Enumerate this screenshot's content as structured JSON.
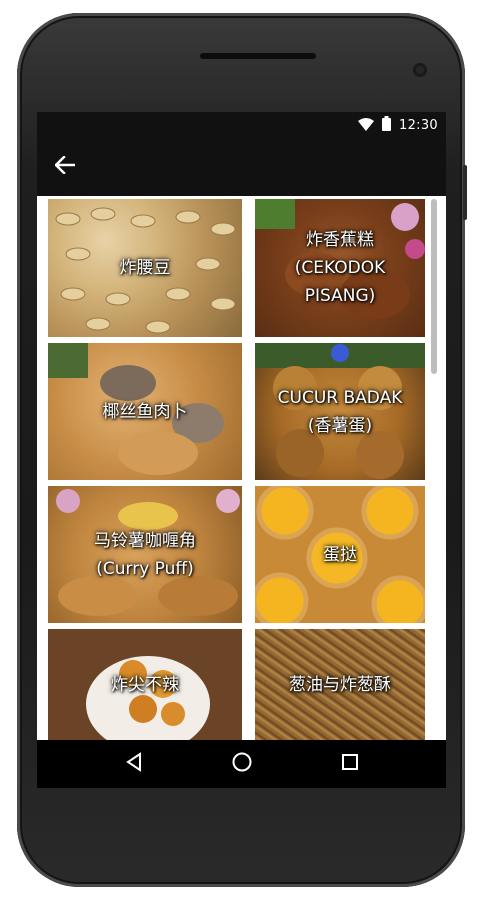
{
  "status_bar": {
    "time": "12:30",
    "icons": [
      "wifi-icon",
      "battery-icon"
    ]
  },
  "app_bar": {
    "back_icon": "arrow-back-icon"
  },
  "grid": {
    "items": [
      {
        "label": "炸腰豆"
      },
      {
        "label": "炸香蕉糕\n(CEKODOK\nPISANG)"
      },
      {
        "label": "椰丝鱼肉卜"
      },
      {
        "label": "CUCUR BADAK\n(香薯蛋)"
      },
      {
        "label": "马铃薯咖喱角\n(Curry Puff)"
      },
      {
        "label": "蛋挞"
      },
      {
        "label": "炸尖不辣"
      },
      {
        "label": "葱油与炸葱酥"
      }
    ]
  },
  "nav_bar": {
    "icons": [
      "nav-back-icon",
      "nav-home-icon",
      "nav-recents-icon"
    ]
  }
}
